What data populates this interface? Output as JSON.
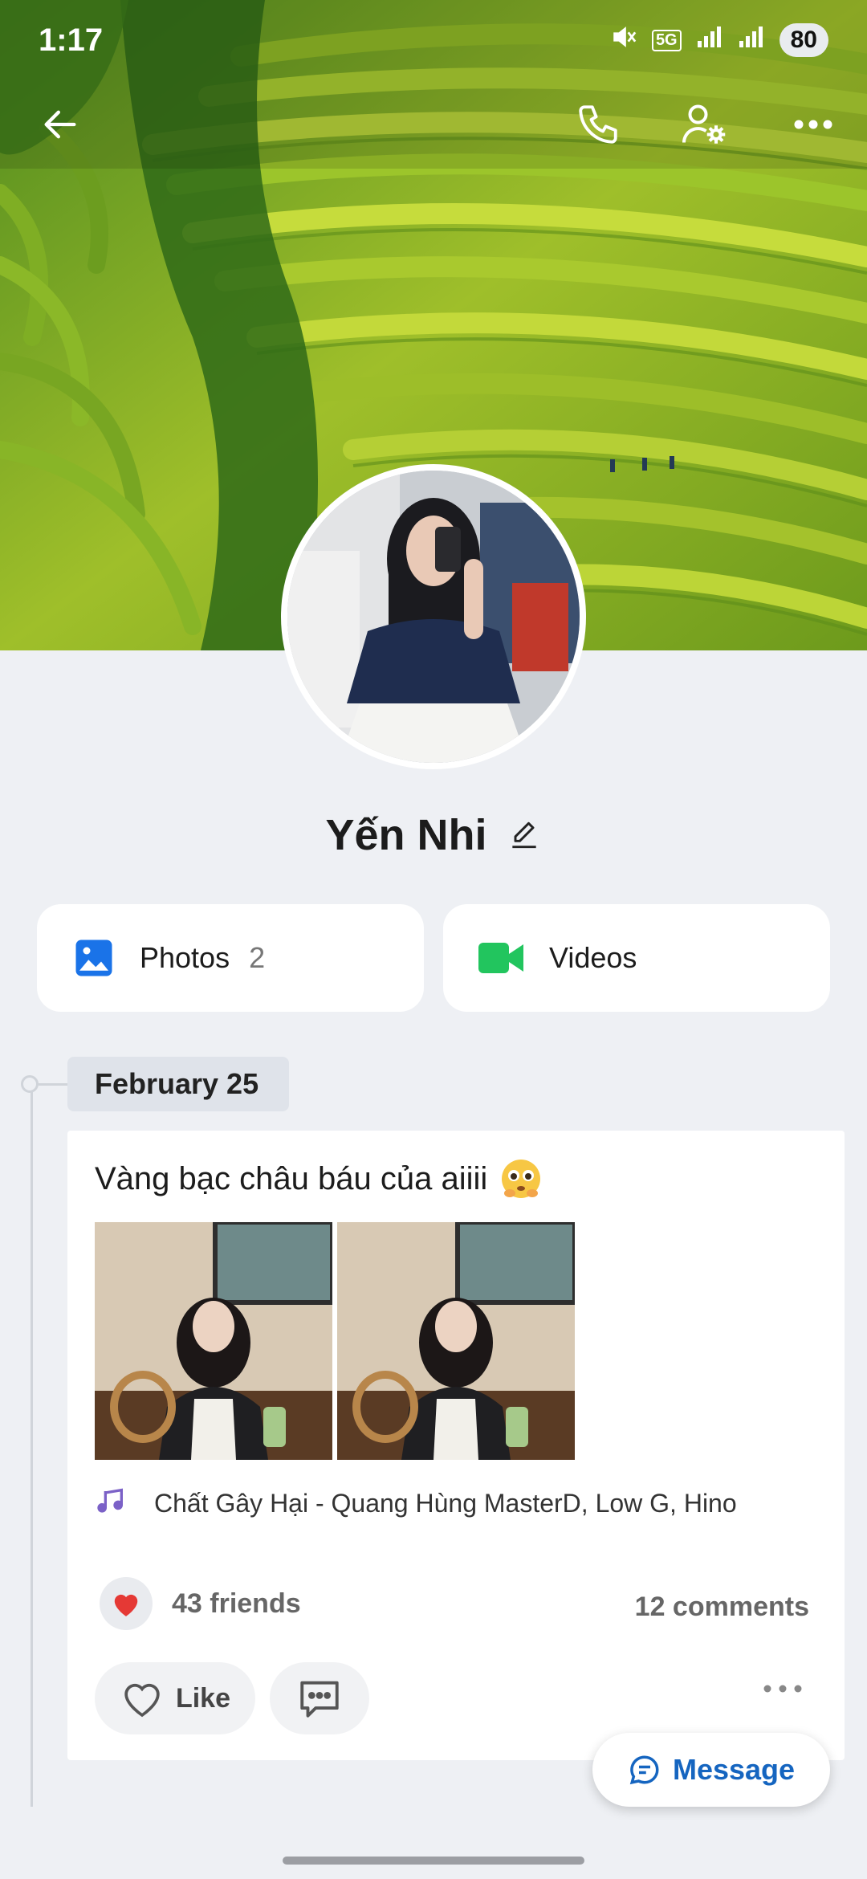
{
  "status_bar": {
    "time": "1:17",
    "battery": "80",
    "network": "5G"
  },
  "profile": {
    "name": "Yến Nhi"
  },
  "media": {
    "photos_label": "Photos",
    "photos_count": "2",
    "videos_label": "Videos"
  },
  "timeline": {
    "date": "February 25"
  },
  "post": {
    "text": "Vàng bạc châu báu của aiiii",
    "music": "Chất Gây Hại - Quang Hùng MasterD, Low G, Hino",
    "reactions": "43 friends",
    "comments": "12 comments",
    "like_label": "Like"
  },
  "message_button": {
    "label": "Message"
  },
  "colors": {
    "accent_blue": "#1565c0",
    "photos_icon": "#1a73e8",
    "videos_icon": "#22c55e",
    "music_icon": "#7b61c7",
    "heart": "#e53935"
  }
}
